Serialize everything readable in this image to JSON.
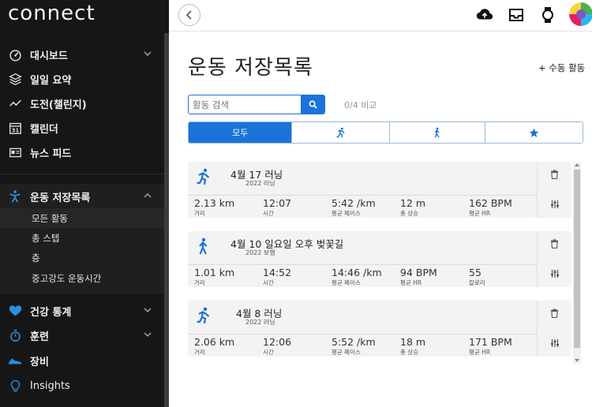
{
  "sidebar": {
    "logo": "connect",
    "items": [
      {
        "label": "대시보드",
        "icon": "gauge-icon"
      },
      {
        "label": "일일 요약",
        "icon": "layers-icon"
      },
      {
        "label": "도전(챌린지)",
        "icon": "trend-icon"
      },
      {
        "label": "캘린더",
        "icon": "calendar-icon",
        "icon_text": "31"
      },
      {
        "label": "뉴스 피드",
        "icon": "newsfeed-icon"
      },
      {
        "label": "운동 저장목록",
        "icon": "activity-person-icon"
      },
      {
        "label": "건강 통계",
        "icon": "heart-icon"
      },
      {
        "label": "훈련",
        "icon": "stopwatch-icon"
      },
      {
        "label": "장비",
        "icon": "shoe-icon"
      },
      {
        "label": "Insights",
        "icon": "lightbulb-icon"
      }
    ],
    "subitems": [
      "모든 활동",
      "총 스텝",
      "층",
      "중고강도 운동시간"
    ]
  },
  "header": {
    "icons": [
      "back-icon",
      "upload-icon",
      "inbox-icon",
      "watch-icon",
      "avatar"
    ]
  },
  "main": {
    "title": "운동 저장목록",
    "manual_add": "+ 수동 활동",
    "search_placeholder": "활동 검색",
    "compare": "0/4 비교",
    "tabs": [
      {
        "label": "모두"
      },
      {
        "label": "",
        "icon": "running-icon"
      },
      {
        "label": "",
        "icon": "walking-icon"
      },
      {
        "label": "",
        "icon": "star-icon"
      }
    ]
  },
  "activities": [
    {
      "title": "4월 17 러닝",
      "year_type": "2022 러닝",
      "icon": "running-icon",
      "stats": [
        {
          "value": "2.13 km",
          "label": "거리"
        },
        {
          "value": "12:07",
          "label": "시간"
        },
        {
          "value": "5:42 /km",
          "label": "평균 페이스"
        },
        {
          "value": "12 m",
          "label": "총 상승"
        },
        {
          "value": "162 BPM",
          "label": "평균 HR"
        }
      ]
    },
    {
      "title": "4월 10 일요일 오후 벚꽃길",
      "year_type": "2022 보행",
      "icon": "walking-icon",
      "stats": [
        {
          "value": "1.01 km",
          "label": "거리"
        },
        {
          "value": "14:52",
          "label": "시간"
        },
        {
          "value": "14:46 /km",
          "label": "평균 페이스"
        },
        {
          "value": "94 BPM",
          "label": "평균 HR"
        },
        {
          "value": "55",
          "label": "칼로리"
        }
      ]
    },
    {
      "title": "4월 8 러닝",
      "year_type": "2022 러닝",
      "icon": "running-icon",
      "stats": [
        {
          "value": "2.06 km",
          "label": "거리"
        },
        {
          "value": "12:06",
          "label": "시간"
        },
        {
          "value": "5:52 /km",
          "label": "평균 페이스"
        },
        {
          "value": "18 m",
          "label": "총 상승"
        },
        {
          "value": "171 BPM",
          "label": "평균 HR"
        }
      ]
    }
  ],
  "colors": {
    "accent": "#1a73d9",
    "sidebar_bg": "#161616",
    "activity_blue": "#1a73d9",
    "heart": "#2b8fde"
  }
}
